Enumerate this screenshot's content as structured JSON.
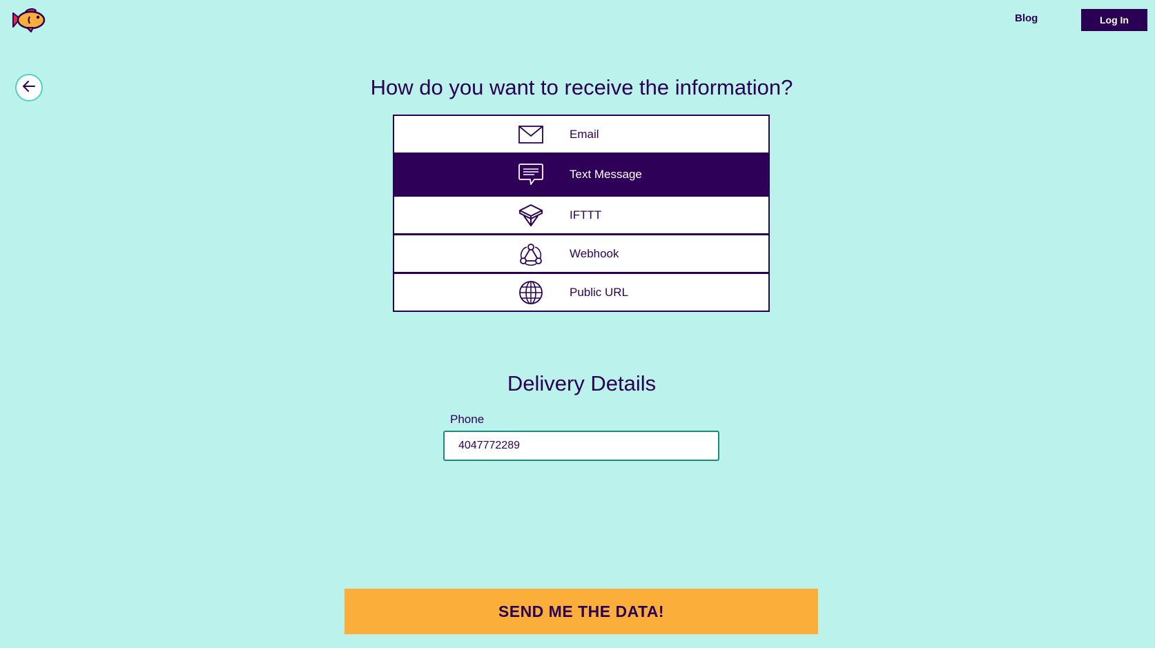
{
  "header": {
    "logo_icon": "fish-logo-icon",
    "blog_label": "Blog",
    "login_label": "Log In"
  },
  "back_icon": "arrow-left-icon",
  "title": "How do you want to receive the information?",
  "options": [
    {
      "label": "Email",
      "icon": "envelope-icon",
      "selected": false
    },
    {
      "label": "Text Message",
      "icon": "chat-bubble-icon",
      "selected": true
    },
    {
      "label": "IFTTT",
      "icon": "ifttt-box-icon",
      "selected": false
    },
    {
      "label": "Webhook",
      "icon": "webhook-icon",
      "selected": false
    },
    {
      "label": "Public URL",
      "icon": "globe-icon",
      "selected": false
    }
  ],
  "delivery": {
    "title": "Delivery Details",
    "phone_label": "Phone",
    "phone_value": "4047772289"
  },
  "submit_label": "SEND ME THE DATA!",
  "colors": {
    "background": "#bbf2ec",
    "primary": "#2a0055",
    "accent": "#fcae3b",
    "input_border": "#1a8a7e"
  }
}
